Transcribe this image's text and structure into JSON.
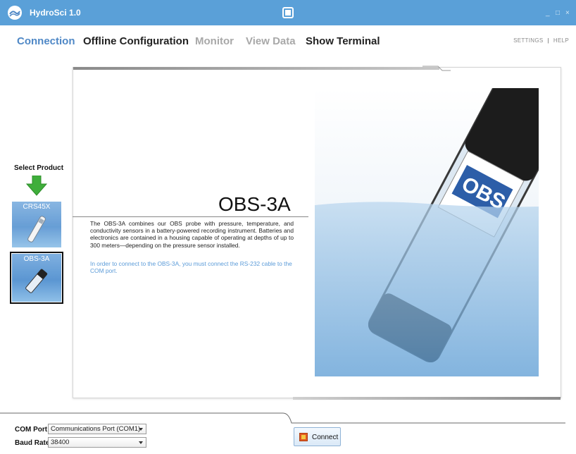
{
  "app": {
    "title": "HydroSci 1.0",
    "window_controls": [
      "_",
      "□",
      "×"
    ]
  },
  "nav": {
    "items": [
      {
        "label": "Connection",
        "state": "active"
      },
      {
        "label": "Offline Configuration",
        "state": "enabled"
      },
      {
        "label": "Monitor",
        "state": "disabled"
      },
      {
        "label": "View Data",
        "state": "disabled"
      },
      {
        "label": "Show Terminal",
        "state": "enabled"
      }
    ],
    "links": {
      "settings": "SETTINGS",
      "separator": "|",
      "help": "HELP"
    }
  },
  "sidebar": {
    "select_label": "Select Product",
    "products": [
      {
        "label": "CRS45X",
        "selected": false
      },
      {
        "label": "OBS-3A",
        "selected": true
      }
    ]
  },
  "main": {
    "product_title": "OBS-3A",
    "description": "The OBS-3A combines our OBS probe with pressure, temperature, and conductivity sensors in a battery-powered recording instrument. Batteries and electronics are contained in a housing capable of operating at depths of up to 300 meters—depending on the pressure sensor installed.",
    "instruction": "In order to connect to the OBS-3A, you must connect the RS-232 cable to the COM port.",
    "image_label": "OBS"
  },
  "bottom": {
    "com_port_label": "COM Port",
    "com_port_value": "Communications Port (COM1)",
    "baud_rate_label": "Baud Rate",
    "baud_rate_value": "38400",
    "connect_label": "Connect"
  },
  "colors": {
    "titlebar": "#5aa0d8",
    "nav_active": "#4f88c6",
    "nav_disabled": "#a8a8a8",
    "instruction_text": "#5b9bd8",
    "arrow_green": "#3fae3b",
    "water": "#a8cbe8"
  }
}
